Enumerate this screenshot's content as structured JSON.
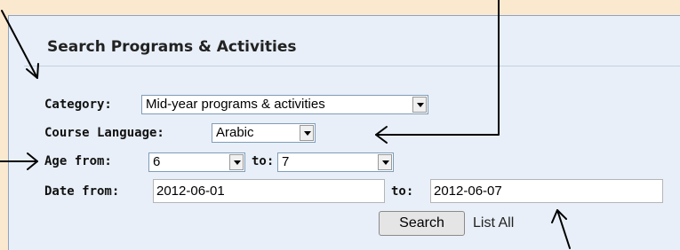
{
  "form": {
    "title": "Search Programs & Activities",
    "category": {
      "label": "Category:",
      "value": "Mid-year programs & activities"
    },
    "course_language": {
      "label": "Course Language:",
      "value": "Arabic"
    },
    "age": {
      "from_label": "Age from:",
      "from_value": "6",
      "to_label": "to:",
      "to_value": "7"
    },
    "date": {
      "from_label": "Date from:",
      "from_value": "2012-06-01",
      "to_label": "to:",
      "to_value": "2012-06-07"
    },
    "search_button": "Search",
    "list_all_link": "List All"
  }
}
